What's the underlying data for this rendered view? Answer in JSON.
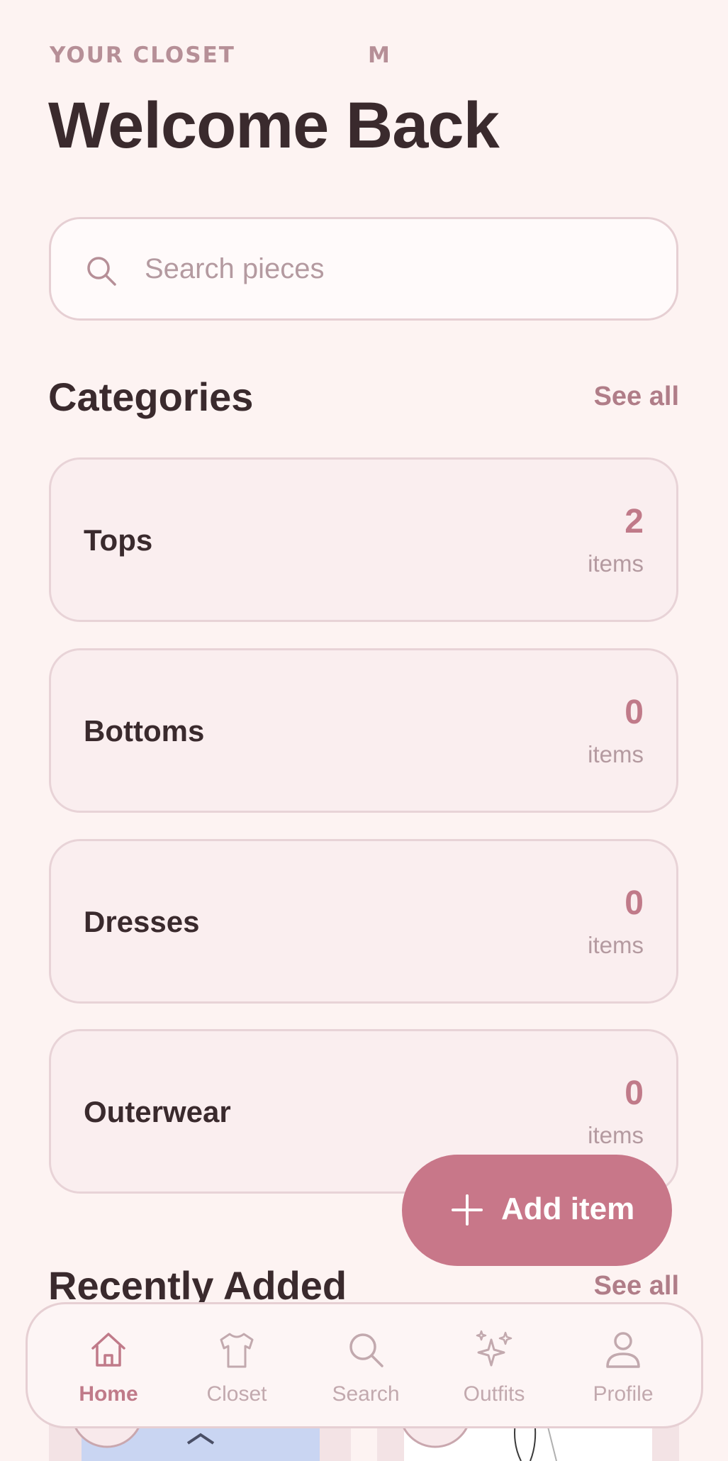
{
  "header": {
    "eyebrow": "YOUR CLOSET",
    "eyebrow_mark": "M",
    "title": "Welcome Back"
  },
  "search": {
    "placeholder": "Search pieces",
    "icon": "search-icon"
  },
  "categories": {
    "title": "Categories",
    "see_all": "See all",
    "items": [
      {
        "name": "Tops",
        "count": "2",
        "unit": "items"
      },
      {
        "name": "Bottoms",
        "count": "0",
        "unit": "items"
      },
      {
        "name": "Dresses",
        "count": "0",
        "unit": "items"
      },
      {
        "name": "Outerwear",
        "count": "0",
        "unit": "items"
      }
    ]
  },
  "recently_added": {
    "title": "Recently Added",
    "see_all": "See all"
  },
  "fab": {
    "label": "Add item",
    "icon": "plus-icon"
  },
  "nav": {
    "items": [
      {
        "label": "Home",
        "icon": "home-icon",
        "active": true
      },
      {
        "label": "Closet",
        "icon": "shirt-icon",
        "active": false
      },
      {
        "label": "Search",
        "icon": "search-icon",
        "active": false
      },
      {
        "label": "Outfits",
        "icon": "sparkles-icon",
        "active": false
      },
      {
        "label": "Profile",
        "icon": "person-icon",
        "active": false
      }
    ]
  },
  "colors": {
    "background": "#fdf3f2",
    "accent": "#c87789",
    "text": "#3a2a2d",
    "muted": "#b49aa0"
  }
}
